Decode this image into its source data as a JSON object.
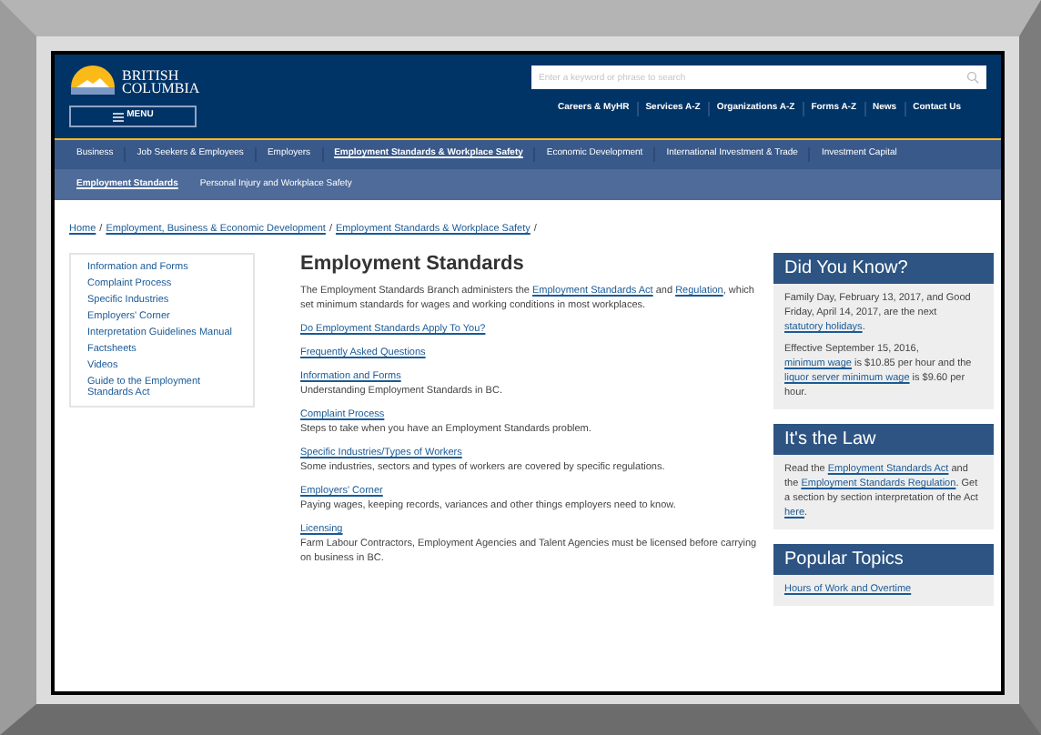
{
  "header": {
    "logo_lines": [
      "BRITISH",
      "COLUMBIA"
    ],
    "search": {
      "placeholder": "Enter a keyword or phrase to search"
    },
    "menu_button": "MENU",
    "top_links": [
      "Careers & MyHR",
      "Services A-Z",
      "Organizations A-Z",
      "Forms A-Z",
      "News",
      "Contact Us"
    ]
  },
  "nav": [
    {
      "label": "Business",
      "selected": false
    },
    {
      "label": "Job Seekers & Employees",
      "selected": false
    },
    {
      "label": "Employers",
      "selected": false
    },
    {
      "label": "Employment Standards & Workplace Safety",
      "selected": true
    },
    {
      "label": "Economic Development",
      "selected": false
    },
    {
      "label": "International Investment & Trade",
      "selected": false
    },
    {
      "label": "Investment Capital",
      "selected": false
    }
  ],
  "subnav": [
    {
      "label": "Employment Standards",
      "selected": true
    },
    {
      "label": "Personal Injury and Workplace Safety",
      "selected": false
    }
  ],
  "breadcrumb": [
    {
      "text": "Home",
      "kind": "link"
    },
    {
      "text": "/",
      "kind": "separator"
    },
    {
      "text": "Employment, Business & Economic Development",
      "kind": "link"
    },
    {
      "text": "/",
      "kind": "separator"
    },
    {
      "text": "Employment Standards & Workplace Safety",
      "kind": "link"
    },
    {
      "text": "/",
      "kind": "separator"
    }
  ],
  "sidebar": {
    "items": [
      "Information and Forms",
      "Complaint Process",
      "Specific Industries",
      "Employers' Corner",
      "Interpretation Guidelines Manual",
      "Factsheets",
      "Videos",
      "Guide to the Employment Standards Act"
    ]
  },
  "main": {
    "title": "Employment Standards",
    "intro": [
      {
        "text": "The Employment Standards Branch administers the ",
        "link": false
      },
      {
        "text": "Employment Standards Act",
        "link": true
      },
      {
        "text": " and ",
        "link": false
      },
      {
        "text": "Regulation",
        "link": true
      },
      {
        "text": ", which set minimum standards for wages and working conditions in most workplaces.",
        "link": false
      }
    ],
    "sections": [
      {
        "link": "Do Employment Standards Apply To You?"
      },
      {
        "link": "Frequently Asked Questions"
      },
      {
        "link": "Information and Forms",
        "description": "Understanding Employment Standards in BC."
      },
      {
        "link": "Complaint Process",
        "description": "Steps to take when you have an Employment Standards problem."
      },
      {
        "link": "Specific Industries/Types of Workers",
        "description": "Some industries, sectors and types of workers are covered by specific regulations."
      },
      {
        "link": "Employers' Corner",
        "description": "Paying wages, keeping records, variances and other things employers need to know."
      },
      {
        "link": "Licensing",
        "description": "Farm Labour Contractors, Employment Agencies and Talent Agencies must be licensed before carrying on business in BC."
      }
    ]
  },
  "aside": [
    {
      "title": "Did You Know?",
      "paragraphs": [
        [
          {
            "text": "Family Day, February 13, 2017, and Good Friday, April 14, 2017, are the next ",
            "link": false
          },
          {
            "text": "statutory holidays",
            "link": true
          },
          {
            "text": ".",
            "link": false
          }
        ],
        [
          {
            "text": "Effective September 15, 2016, ",
            "link": false
          },
          {
            "text": "minimum wage",
            "link": true
          },
          {
            "text": " is $10.85 per hour and the ",
            "link": false
          },
          {
            "text": "liquor server minimum wage",
            "link": true
          },
          {
            "text": " is $9.60 per hour.",
            "link": false
          }
        ]
      ]
    },
    {
      "title": "It's the Law",
      "paragraphs": [
        [
          {
            "text": "Read the ",
            "link": false
          },
          {
            "text": "Employment Standards Act",
            "link": true
          },
          {
            "text": " and the ",
            "link": false
          },
          {
            "text": "Employment Standards Regulation",
            "link": true
          },
          {
            "text": ". Get a section by section interpretation of the Act ",
            "link": false
          },
          {
            "text": "here",
            "link": true
          },
          {
            "text": ".",
            "link": false
          }
        ]
      ]
    },
    {
      "title": "Popular Topics",
      "links": [
        "Hours of Work and Overtime"
      ]
    }
  ]
}
